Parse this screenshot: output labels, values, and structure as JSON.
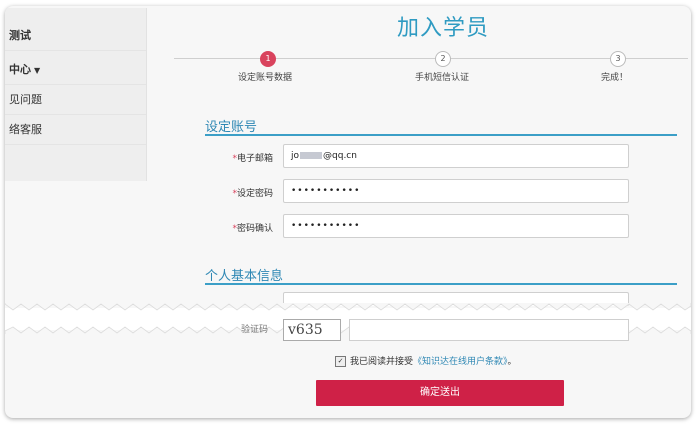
{
  "sidebar": {
    "items": [
      {
        "label": "测试"
      },
      {
        "label": "中心"
      },
      {
        "label": "见问题"
      },
      {
        "label": "络客服"
      }
    ]
  },
  "page_title": "加入学员",
  "steps": [
    {
      "number": "1",
      "label": "设定账号数据"
    },
    {
      "number": "2",
      "label": "手机短信认证"
    },
    {
      "number": "3",
      "label": "完成！"
    }
  ],
  "account_section": {
    "title": "设定账号",
    "fields": [
      {
        "required_mark": "*",
        "label": "电子邮箱",
        "value_prefix": "jo",
        "value_suffix": "@qq.cn"
      },
      {
        "required_mark": "*",
        "label": "设定密码",
        "value": "•••••••••••"
      },
      {
        "required_mark": "*",
        "label": "密码确认",
        "value": "•••••••••••"
      }
    ]
  },
  "personal_section": {
    "title": "个人基本信息"
  },
  "captcha": {
    "partial_label": "验证码",
    "code": "v635"
  },
  "agreement": {
    "checked_glyph": "✓",
    "text_before": "我已阅读并接受",
    "link_text": "《知识达在线用户条款》",
    "text_after": "。"
  },
  "submit_label": "确定送出",
  "icons": {
    "dropdown": "chevron-down-icon",
    "checkbox": "checkbox-checked-icon"
  },
  "colors": {
    "accent": "#2f9bc2",
    "step_active": "#d9435d",
    "submit": "#cf2147"
  }
}
